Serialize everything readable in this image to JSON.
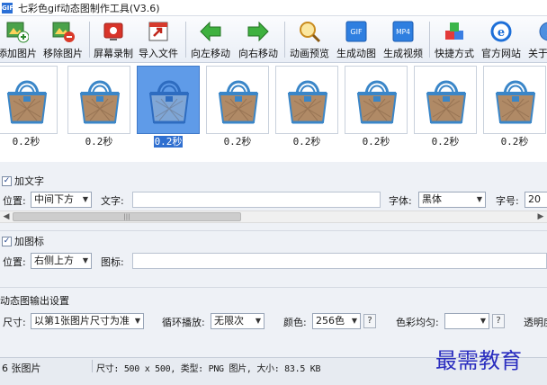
{
  "window": {
    "app_icon_text": "GIF",
    "title": "七彩色gif动态图制作工具(V3.6)"
  },
  "toolbar": {
    "buttons": [
      {
        "label": "添加图片",
        "icon": "add-image-icon"
      },
      {
        "label": "移除图片",
        "icon": "remove-image-icon"
      },
      {
        "label": "屏幕录制",
        "icon": "screen-record-icon"
      },
      {
        "label": "导入文件",
        "icon": "import-file-icon"
      },
      {
        "label": "向左移动",
        "icon": "arrow-left-icon"
      },
      {
        "label": "向右移动",
        "icon": "arrow-right-icon"
      },
      {
        "label": "动画预览",
        "icon": "preview-magnifier-icon"
      },
      {
        "label": "生成动图",
        "icon": "gif-icon",
        "badge": "GIF"
      },
      {
        "label": "生成视频",
        "icon": "mp4-icon",
        "badge": "MP4"
      },
      {
        "label": "快捷方式",
        "icon": "shortcut-cubes-icon"
      },
      {
        "label": "官方网站",
        "icon": "browser-icon"
      },
      {
        "label": "关于",
        "icon": "about-icon"
      }
    ]
  },
  "frames": {
    "items": [
      {
        "duration": "0.2秒",
        "selected": false
      },
      {
        "duration": "0.2秒",
        "selected": false
      },
      {
        "duration": "0.2秒",
        "selected": true
      },
      {
        "duration": "0.2秒",
        "selected": false
      },
      {
        "duration": "0.2秒",
        "selected": false
      },
      {
        "duration": "0.2秒",
        "selected": false
      },
      {
        "duration": "0.2秒",
        "selected": false
      },
      {
        "duration": "0.2秒",
        "selected": false
      }
    ],
    "scroll_grip": "|||"
  },
  "text_section": {
    "checkbox_label": "加文字",
    "checked": true,
    "position_label": "位置:",
    "position_value": "中间下方",
    "text_label": "文字:",
    "text_value": "",
    "font_label": "字体:",
    "font_value": "黑体",
    "size_label": "字号:",
    "size_value": "20"
  },
  "icon_section": {
    "checkbox_label": "加图标",
    "checked": true,
    "position_label": "位置:",
    "position_value": "右侧上方",
    "icon_label": "图标:",
    "icon_value": ""
  },
  "output_section": {
    "title": "动态图输出设置",
    "size_label": "尺寸:",
    "size_value": "以第1张图片尺寸为准",
    "loop_label": "循环播放:",
    "loop_value": "无限次",
    "color_label": "颜色:",
    "color_value": "256色",
    "help_label": "?",
    "dither_label": "色彩均匀:",
    "dither_value": "",
    "transparency_label": "透明度"
  },
  "status": {
    "count": "6 张图片",
    "info": "尺寸: 500 x 500, 类型: PNG 图片, 大小: 83.5 KB"
  },
  "watermark": "最需教育",
  "colors": {
    "accent": "#2f6fd0",
    "selected_thumb": "#5f9be8",
    "watermark": "#2a2dbf"
  }
}
